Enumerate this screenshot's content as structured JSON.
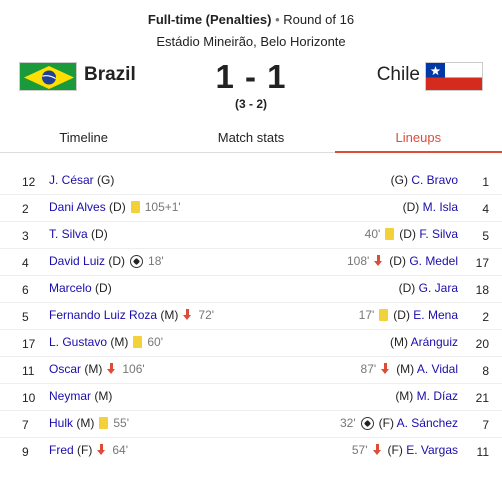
{
  "header": {
    "status": "Full-time (Penalties)",
    "separator": "•",
    "round": "Round of 16",
    "venue": "Estádio Mineirão, Belo Horizonte"
  },
  "match": {
    "home_team": "Brazil",
    "away_team": "Chile",
    "score": "1 - 1",
    "penalties": "(3 - 2)"
  },
  "tabs": [
    {
      "label": "Timeline",
      "active": false
    },
    {
      "label": "Match stats",
      "active": false
    },
    {
      "label": "Lineups",
      "active": true
    }
  ],
  "lineups": [
    {
      "home_num": "12",
      "home_name": "J. César",
      "home_pos": "(G)",
      "home_events": [],
      "away_num": "1",
      "away_name": "C. Bravo",
      "away_pos": "(G)",
      "away_events": []
    },
    {
      "home_num": "2",
      "home_name": "Dani Alves",
      "home_pos": "(D)",
      "home_events": [
        {
          "type": "yellow-card",
          "minute": "105+1'"
        }
      ],
      "away_num": "4",
      "away_name": "M. Isla",
      "away_pos": "(D)",
      "away_events": []
    },
    {
      "home_num": "3",
      "home_name": "T. Silva",
      "home_pos": "(D)",
      "home_events": [],
      "away_num": "5",
      "away_name": "F. Silva",
      "away_pos": "(D)",
      "away_events": [
        {
          "type": "yellow-card",
          "minute": "40'"
        }
      ]
    },
    {
      "home_num": "4",
      "home_name": "David Luiz",
      "home_pos": "(D)",
      "home_events": [
        {
          "type": "goal",
          "minute": "18'"
        }
      ],
      "away_num": "17",
      "away_name": "G. Medel",
      "away_pos": "(D)",
      "away_events": [
        {
          "type": "sub-off",
          "minute": "108'"
        }
      ]
    },
    {
      "home_num": "6",
      "home_name": "Marcelo",
      "home_pos": "(D)",
      "home_events": [],
      "away_num": "18",
      "away_name": "G. Jara",
      "away_pos": "(D)",
      "away_events": []
    },
    {
      "home_num": "5",
      "home_name": "Fernando Luiz Roza",
      "home_pos": "(M)",
      "home_events": [
        {
          "type": "sub-off",
          "minute": "72'"
        }
      ],
      "away_num": "2",
      "away_name": "E. Mena",
      "away_pos": "(D)",
      "away_events": [
        {
          "type": "yellow-card",
          "minute": "17'"
        }
      ]
    },
    {
      "home_num": "17",
      "home_name": "L. Gustavo",
      "home_pos": "(M)",
      "home_events": [
        {
          "type": "yellow-card",
          "minute": "60'"
        }
      ],
      "away_num": "20",
      "away_name": "Aránguiz",
      "away_pos": "(M)",
      "away_events": []
    },
    {
      "home_num": "11",
      "home_name": "Oscar",
      "home_pos": "(M)",
      "home_events": [
        {
          "type": "sub-off",
          "minute": "106'"
        }
      ],
      "away_num": "8",
      "away_name": "A. Vidal",
      "away_pos": "(M)",
      "away_events": [
        {
          "type": "sub-off",
          "minute": "87'"
        }
      ]
    },
    {
      "home_num": "10",
      "home_name": "Neymar",
      "home_pos": "(M)",
      "home_events": [],
      "away_num": "21",
      "away_name": "M. Díaz",
      "away_pos": "(M)",
      "away_events": []
    },
    {
      "home_num": "7",
      "home_name": "Hulk",
      "home_pos": "(M)",
      "home_events": [
        {
          "type": "yellow-card",
          "minute": "55'"
        }
      ],
      "away_num": "7",
      "away_name": "A. Sánchez",
      "away_pos": "(F)",
      "away_events": [
        {
          "type": "goal",
          "minute": "32'"
        }
      ]
    },
    {
      "home_num": "9",
      "home_name": "Fred",
      "home_pos": "(F)",
      "home_events": [
        {
          "type": "sub-off",
          "minute": "64'"
        }
      ],
      "away_num": "11",
      "away_name": "E. Vargas",
      "away_pos": "(F)",
      "away_events": [
        {
          "type": "sub-off",
          "minute": "57'"
        }
      ]
    }
  ],
  "colors": {
    "accent": "#dd4b39",
    "link": "#1a0dab",
    "yellow_card": "#f3d13b"
  },
  "icons": {
    "yellow_card": "yellow-card-icon",
    "goal": "soccer-ball-icon",
    "sub_off": "substitution-arrow-icon",
    "home_flag": "brazil-flag-icon",
    "away_flag": "chile-flag-icon"
  }
}
